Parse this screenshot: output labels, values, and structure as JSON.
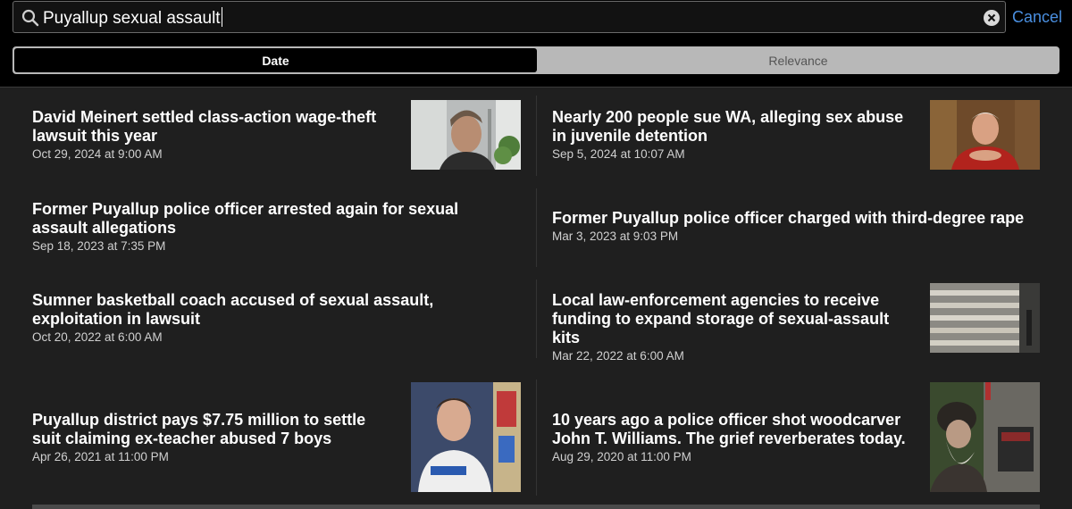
{
  "search": {
    "query": "Puyallup sexual assault",
    "cancel_label": "Cancel"
  },
  "sort": {
    "options": [
      "Date",
      "Relevance"
    ],
    "selected": "Date"
  },
  "results": [
    {
      "headline": "David Meinert settled class-action wage-theft lawsuit this year",
      "date": "Oct 29, 2024 at 9:00 AM",
      "thumbnail": "man-portrait-photo"
    },
    {
      "headline": "Nearly 200 people sue WA, alleging sex abuse in juvenile detention",
      "date": "Sep 5, 2024 at 10:07 AM",
      "thumbnail": "man-red-shirt-photo"
    },
    {
      "headline": "Former Puyallup police officer arrested again for sexual assault allegations",
      "date": "Sep 18, 2023 at 7:35 PM"
    },
    {
      "headline": "Former Puyallup police officer charged with third-degree rape",
      "date": "Mar 3, 2023 at 9:03 PM"
    },
    {
      "headline": "Sumner basketball coach accused of sexual assault, exploitation in lawsuit",
      "date": "Oct 20, 2022 at 6:00 AM"
    },
    {
      "headline": "Local law-enforcement agencies to receive funding to expand storage of sexual-assault kits",
      "date": "Mar 22, 2022 at 6:00 AM",
      "thumbnail": "evidence-shelves-photo"
    },
    {
      "headline": "Puyallup district pays $7.75 million to settle suit claiming ex-teacher abused 7 boys",
      "date": "Apr 26, 2021 at 11:00 PM",
      "thumbnail": "yearbook-boy-photo"
    },
    {
      "headline": "10 years ago a police officer shot woodcarver John T. Williams. The grief reverberates today.",
      "date": "Aug 29, 2020 at 11:00 PM",
      "thumbnail": "woodcarver-memorial-photo"
    }
  ],
  "colors": {
    "background": "#1f1f1f",
    "accent": "#4a8fe0"
  }
}
